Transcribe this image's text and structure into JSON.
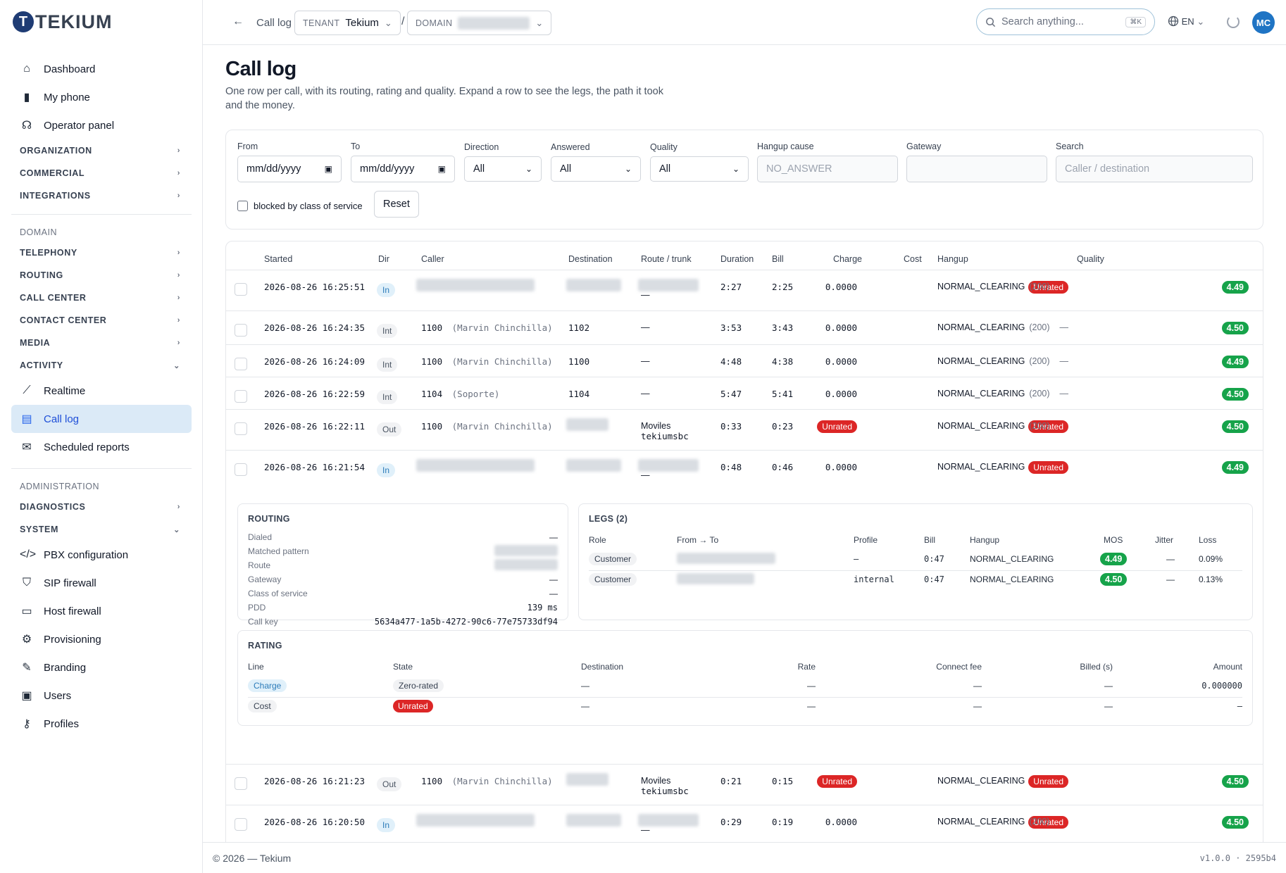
{
  "brand": {
    "name": "TEKIUM",
    "mark": "T"
  },
  "sidebar": {
    "top": [
      {
        "label": "Dashboard",
        "icon": "home-icon",
        "glyph": "⌂"
      },
      {
        "label": "My phone",
        "icon": "phone-icon",
        "glyph": "▮"
      },
      {
        "label": "Operator panel",
        "icon": "headset-icon",
        "glyph": "☊"
      }
    ],
    "groups1": [
      {
        "label": "ORGANIZATION",
        "chev": "›"
      },
      {
        "label": "COMMERCIAL",
        "chev": "›"
      },
      {
        "label": "INTEGRATIONS",
        "chev": "›"
      }
    ],
    "section_domain": "DOMAIN",
    "groups2": [
      {
        "label": "TELEPHONY",
        "chev": "›"
      },
      {
        "label": "ROUTING",
        "chev": "›"
      },
      {
        "label": "CALL CENTER",
        "chev": "›"
      },
      {
        "label": "CONTACT CENTER",
        "chev": "›"
      },
      {
        "label": "MEDIA",
        "chev": "›"
      },
      {
        "label": "ACTIVITY",
        "chev": "⌄"
      }
    ],
    "activity": [
      {
        "label": "Realtime",
        "icon": "chart-icon",
        "glyph": "⟋"
      },
      {
        "label": "Call log",
        "icon": "document-icon",
        "glyph": "▤"
      },
      {
        "label": "Scheduled reports",
        "icon": "mail-icon",
        "glyph": "✉"
      }
    ],
    "section_admin": "ADMINISTRATION",
    "groups3": [
      {
        "label": "DIAGNOSTICS",
        "chev": "›"
      },
      {
        "label": "SYSTEM",
        "chev": "⌄"
      }
    ],
    "system": [
      {
        "label": "PBX configuration",
        "icon": "code-icon",
        "glyph": "</>"
      },
      {
        "label": "SIP firewall",
        "icon": "shield-icon",
        "glyph": "⛉"
      },
      {
        "label": "Host firewall",
        "icon": "monitor-icon",
        "glyph": "▭"
      },
      {
        "label": "Provisioning",
        "icon": "gear-icon",
        "glyph": "⚙"
      },
      {
        "label": "Branding",
        "icon": "brush-icon",
        "glyph": "✎"
      },
      {
        "label": "Users",
        "icon": "id-card-icon",
        "glyph": "▣"
      },
      {
        "label": "Profiles",
        "icon": "key-icon",
        "glyph": "⚷"
      }
    ]
  },
  "topbar": {
    "back": "←",
    "crumb": "Call log",
    "tenant_key": "TENANT",
    "tenant_val": "Tekium",
    "slash": "/",
    "domain_key": "DOMAIN",
    "search_placeholder": "Search anything...",
    "search_kbd": "⌘K",
    "lang": "EN",
    "avatar": "MC",
    "chev": "⌄"
  },
  "page": {
    "title": "Call log",
    "subtitle": "One row per call, with its routing, rating and quality. Expand a row to see the legs, the path it took and the money."
  },
  "filters": {
    "from_label": "From",
    "from_val": "mm/dd/yyyy",
    "to_label": "To",
    "to_val": "mm/dd/yyyy",
    "direction_label": "Direction",
    "direction_val": "All",
    "answered_label": "Answered",
    "answered_val": "All",
    "quality_label": "Quality",
    "quality_val": "All",
    "hangup_label": "Hangup cause",
    "hangup_ph": "NO_ANSWER",
    "gateway_label": "Gateway",
    "search_label": "Search",
    "search_ph": "Caller / destination",
    "blocked_label": "blocked by class of service",
    "reset": "Reset"
  },
  "table": {
    "headers": {
      "started": "Started",
      "dir": "Dir",
      "caller": "Caller",
      "destination": "Destination",
      "route": "Route / trunk",
      "duration": "Duration",
      "bill": "Bill",
      "charge": "Charge",
      "cost": "Cost",
      "hangup": "Hangup",
      "quality": "Quality"
    },
    "rows": [
      {
        "started": "2026-08-26 16:25:51",
        "dir": "In",
        "caller_num": "",
        "caller_name": "",
        "dest": "",
        "route": "",
        "route2": "—",
        "duration": "2:27",
        "bill": "2:25",
        "charge": "0.0000",
        "cost": "Unrated",
        "hangup": "NORMAL_CLEARING",
        "code": "(200)",
        "quality": "4.49"
      },
      {
        "started": "2026-08-26 16:24:35",
        "dir": "Int",
        "caller_num": "1100",
        "caller_name": "(Marvin Chinchilla)",
        "dest": "1102",
        "route": "—",
        "route2": "",
        "duration": "3:53",
        "bill": "3:43",
        "charge": "0.0000",
        "cost": "—",
        "hangup": "NORMAL_CLEARING",
        "code": "(200)",
        "quality": "4.50"
      },
      {
        "started": "2026-08-26 16:24:09",
        "dir": "Int",
        "caller_num": "1100",
        "caller_name": "(Marvin Chinchilla)",
        "dest": "1100",
        "route": "—",
        "route2": "",
        "duration": "4:48",
        "bill": "4:38",
        "charge": "0.0000",
        "cost": "—",
        "hangup": "NORMAL_CLEARING",
        "code": "(200)",
        "quality": "4.49"
      },
      {
        "started": "2026-08-26 16:22:59",
        "dir": "Int",
        "caller_num": "1104",
        "caller_name": "(Soporte)",
        "dest": "1104",
        "route": "—",
        "route2": "",
        "duration": "5:47",
        "bill": "5:41",
        "charge": "0.0000",
        "cost": "—",
        "hangup": "NORMAL_CLEARING",
        "code": "(200)",
        "quality": "4.50"
      },
      {
        "started": "2026-08-26 16:22:11",
        "dir": "Out",
        "caller_num": "1100",
        "caller_name": "(Marvin Chinchilla)",
        "dest": "",
        "route": "Moviles",
        "route2": "tekiumsbc",
        "duration": "0:33",
        "bill": "0:23",
        "charge": "Unrated",
        "cost": "Unrated",
        "hangup": "NORMAL_CLEARING",
        "code": "(200)",
        "quality": "4.50"
      },
      {
        "started": "2026-08-26 16:21:54",
        "dir": "In",
        "caller_num": "",
        "caller_name": "",
        "dest": "",
        "route": "",
        "route2": "—",
        "duration": "0:48",
        "bill": "0:46",
        "charge": "0.0000",
        "cost": "Unrated",
        "hangup": "NORMAL_CLEARING",
        "code": "",
        "quality": "4.49"
      }
    ],
    "rows_after": [
      {
        "started": "2026-08-26 16:21:23",
        "dir": "Out",
        "caller_num": "1100",
        "caller_name": "(Marvin Chinchilla)",
        "dest": "",
        "route": "Moviles",
        "route2": "tekiumsbc",
        "duration": "0:21",
        "bill": "0:15",
        "charge": "Unrated",
        "cost": "Unrated",
        "hangup": "NORMAL_CLEARING",
        "code": "",
        "quality": "4.50"
      },
      {
        "started": "2026-08-26 16:20:50",
        "dir": "In",
        "caller_num": "",
        "caller_name": "",
        "dest": "",
        "route": "",
        "route2": "—",
        "duration": "0:29",
        "bill": "0:19",
        "charge": "0.0000",
        "cost": "Unrated",
        "hangup": "NORMAL_CLEARING",
        "code": "(200)",
        "quality": "4.50"
      }
    ]
  },
  "detail": {
    "routing_title": "ROUTING",
    "routing": [
      {
        "label": "Dialed",
        "value": "—"
      },
      {
        "label": "Matched pattern",
        "value": ""
      },
      {
        "label": "Route",
        "value": ""
      },
      {
        "label": "Gateway",
        "value": "—"
      },
      {
        "label": "Class of service",
        "value": "—"
      },
      {
        "label": "PDD",
        "value": "139 ms"
      },
      {
        "label": "Call key",
        "value": "5634a477-1a5b-4272-90c6-77e75733df94"
      }
    ],
    "legs_title": "LEGS (2)",
    "legs_headers": {
      "role": "Role",
      "fromto": "From → To",
      "profile": "Profile",
      "bill": "Bill",
      "hangup": "Hangup",
      "mos": "MOS",
      "jitter": "Jitter",
      "loss": "Loss"
    },
    "legs": [
      {
        "role": "Customer",
        "profile": "—",
        "bill": "0:47",
        "hangup": "NORMAL_CLEARING",
        "mos": "4.49",
        "jitter": "—",
        "loss": "0.09%"
      },
      {
        "role": "Customer",
        "profile": "internal",
        "bill": "0:47",
        "hangup": "NORMAL_CLEARING",
        "mos": "4.50",
        "jitter": "—",
        "loss": "0.13%"
      }
    ],
    "rating_title": "RATING",
    "rating_headers": {
      "line": "Line",
      "state": "State",
      "destination": "Destination",
      "rate": "Rate",
      "connect": "Connect fee",
      "billed": "Billed (s)",
      "amount": "Amount"
    },
    "rating": [
      {
        "line": "Charge",
        "state": "Zero-rated",
        "destination": "—",
        "rate": "—",
        "connect": "—",
        "billed": "—",
        "amount": "0.000000"
      },
      {
        "line": "Cost",
        "state": "Unrated",
        "destination": "—",
        "rate": "—",
        "connect": "—",
        "billed": "—",
        "amount": "—"
      }
    ]
  },
  "footer": {
    "copyright": "© 2026 — Tekium",
    "version": "v1.0.0 · 2595b4"
  },
  "colors": {
    "accent": "#2563eb",
    "danger": "#dc2626",
    "success": "#16a34a"
  }
}
